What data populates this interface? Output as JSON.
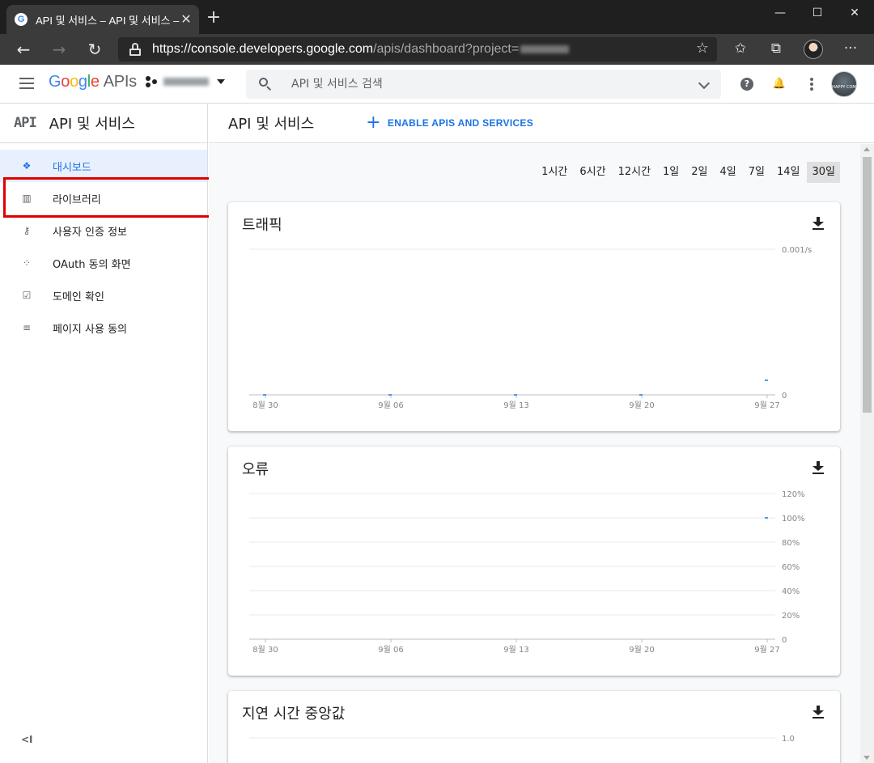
{
  "browser": {
    "tab_title": "API 및 서비스 – API 및 서비스 – Google Cloud Platform",
    "favicon_letter": "G",
    "close_glyph": "✕",
    "newtab_glyph": "+",
    "minimize_glyph": "—",
    "maximize_glyph": "☐",
    "window_close_glyph": "✕",
    "back_glyph": "←",
    "forward_glyph": "→",
    "refresh_glyph": "↻",
    "url_host": "https://console.developers.google.com",
    "url_path": "/apis/dashboard?project=",
    "star_glyph": "☆",
    "favorites_glyph": "✩",
    "collections_glyph": "⧉",
    "more_glyph": "···"
  },
  "header": {
    "logo_letters": [
      "G",
      "o",
      "o",
      "g",
      "l",
      "e"
    ],
    "logo_suffix": "APIs",
    "search_placeholder": "API 및 서비스 검색",
    "help_glyph": "?",
    "bell_glyph": "🔔",
    "avatar_text": "HAPPY COM"
  },
  "sidebar": {
    "badge": "API",
    "title": "API 및 서비스",
    "items": [
      {
        "label": "대시보드",
        "icon": "dashboard-icon",
        "glyph": "❖",
        "active": true
      },
      {
        "label": "라이브러리",
        "icon": "library-icon",
        "glyph": "▥",
        "active": false
      },
      {
        "label": "사용자 인증 정보",
        "icon": "key-icon",
        "glyph": "⚷",
        "active": false
      },
      {
        "label": "OAuth 동의 화면",
        "icon": "oauth-consent-icon",
        "glyph": "⁘",
        "active": false
      },
      {
        "label": "도메인 확인",
        "icon": "domain-check-icon",
        "glyph": "☑",
        "active": false
      },
      {
        "label": "페이지 사용 동의",
        "icon": "page-agreement-icon",
        "glyph": "≡",
        "active": false
      }
    ],
    "collapse_glyph": "<I"
  },
  "main": {
    "title": "API 및 서비스",
    "enable_button": "ENABLE APIS AND SERVICES",
    "time_ranges": [
      {
        "label": "1시간",
        "selected": false
      },
      {
        "label": "6시간",
        "selected": false
      },
      {
        "label": "12시간",
        "selected": false
      },
      {
        "label": "1일",
        "selected": false
      },
      {
        "label": "2일",
        "selected": false
      },
      {
        "label": "4일",
        "selected": false
      },
      {
        "label": "7일",
        "selected": false
      },
      {
        "label": "14일",
        "selected": false
      },
      {
        "label": "30일",
        "selected": true
      }
    ]
  },
  "chart_data": [
    {
      "type": "line",
      "title": "트래픽",
      "categories": [
        "8월 30",
        "9월 06",
        "9월 13",
        "9월 20",
        "9월 27"
      ],
      "y_ticks": [
        "0.001/s",
        "0"
      ],
      "ylim": [
        0,
        0.001
      ],
      "series": [
        {
          "values": [
            0,
            0,
            0,
            0,
            0.0001
          ]
        }
      ],
      "grid": true
    },
    {
      "type": "line",
      "title": "오류",
      "categories": [
        "8월 30",
        "9월 06",
        "9월 13",
        "9월 20",
        "9월 27"
      ],
      "y_ticks": [
        "120%",
        "100%",
        "80%",
        "60%",
        "40%",
        "20%",
        "0"
      ],
      "ylim": [
        0,
        120
      ],
      "series": [
        {
          "values": [
            null,
            null,
            null,
            null,
            100
          ]
        }
      ],
      "grid": true
    },
    {
      "type": "line",
      "title": "지연 시간 중앙값",
      "y_ticks": [
        "1.0"
      ],
      "grid": true
    }
  ],
  "colors": {
    "accent": "#1a73e8",
    "highlight": "#e00000",
    "series": "#1a73e8"
  }
}
